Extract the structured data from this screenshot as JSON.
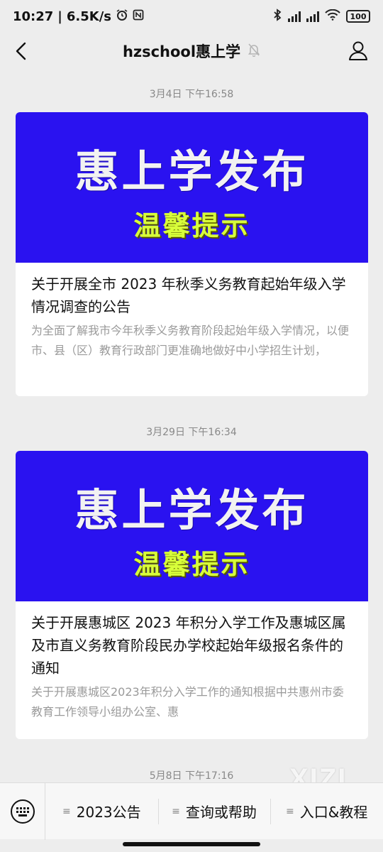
{
  "status_bar": {
    "time": "10:27",
    "separator": "|",
    "speed": "6.5K/s",
    "battery": "100"
  },
  "nav": {
    "title": "hzschool惠上学"
  },
  "messages": [
    {
      "timestamp": "3月4日 下午16:58",
      "banner_main": "惠上学发布",
      "banner_sub": "温馨提示",
      "title": "关于开展全市 2023 年秋季义务教育起始年级入学情况调查的公告",
      "digest": "为全面了解我市今年秋季义务教育阶段起始年级入学情况，以便市、县（区）教育行政部门更准确地做好中小学招生计划，"
    },
    {
      "timestamp": "3月29日 下午16:34",
      "banner_main": "惠上学发布",
      "banner_sub": "温馨提示",
      "title": "关于开展惠城区 2023 年积分入学工作及惠城区属及市直义务教育阶段民办学校起始年级报名条件的通知",
      "digest": "关于开展惠城区2023年积分入学工作的通知根据中共惠州市委教育工作领导小组办公室、惠"
    },
    {
      "timestamp": "5月8日 下午17:16"
    }
  ],
  "bottom_menu": {
    "items": [
      {
        "label": "2023公告",
        "icon": "menu-lines-icon"
      },
      {
        "label": "查询或帮助",
        "icon": "menu-lines-icon"
      },
      {
        "label": "入口&教程",
        "icon": "menu-lines-icon"
      }
    ]
  },
  "watermark": "XIZI",
  "colors": {
    "banner_bg": "#2a12f0",
    "banner_sub": "#d8ff3a",
    "page_bg": "#ededed"
  }
}
